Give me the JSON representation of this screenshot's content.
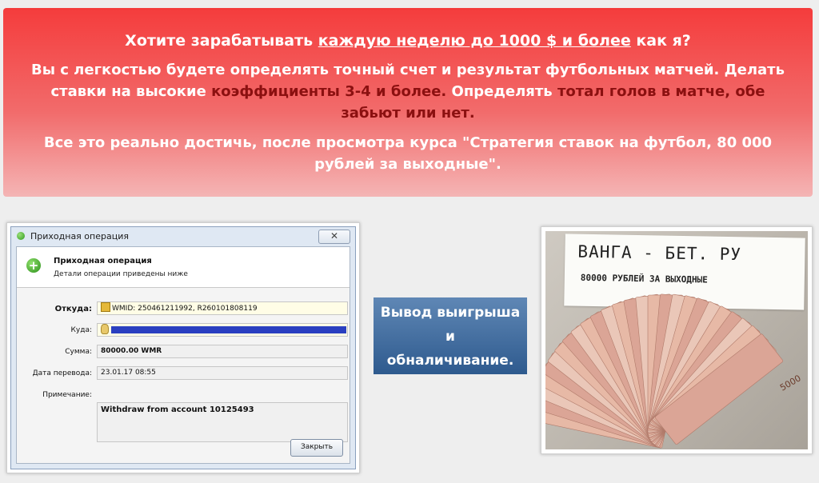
{
  "banner": {
    "line1_a": "Хотите зарабатывать ",
    "line1_link": "каждую неделю до 1000 $ и более",
    "line1_b": " как я?",
    "line2_a": "Вы с легкостью будете определять точный счет и результат футбольных матчей. Делать ставки на высокие ",
    "line2_hl1": "коэффициенты 3-4 и более.",
    "line2_b": " Определять ",
    "line2_hl2": "тотал голов в матче, обе забьют или нет.",
    "line3": "Все это реально достичь, после просмотра курса \"Стратегия ставок на футбол, 80 000 рублей за выходные\"."
  },
  "dialog": {
    "window_title": "Приходная операция",
    "close_x": "✕",
    "header_title": "Приходная операция",
    "header_subtitle": "Детали операции приведены ниже",
    "from_label": "Откуда:",
    "from_value": "WMID: 250461211992, R260101808119",
    "to_label": "Куда:",
    "amount_label": "Сумма:",
    "amount_value": "80000.00 WMR",
    "date_label": "Дата перевода:",
    "date_value": "23.01.17 08:55",
    "note_label": "Примечание:",
    "note_value": "Withdraw from account 10125493",
    "close_button": "Закрыть"
  },
  "cta": {
    "line1": "Вывод выигрыша",
    "line2": "и",
    "line3": "обналичивание."
  },
  "photo": {
    "sign_line1": "ВАНГА - БЕТ. РУ",
    "sign_line2": "80000 РУБЛЕЙ ЗА ВЫХОДНЫЕ",
    "note_5000": "5000"
  },
  "colors": {
    "banner_top": "#f43c3c",
    "highlight_text": "#8b1010",
    "cta_blue": "#3d6699"
  }
}
